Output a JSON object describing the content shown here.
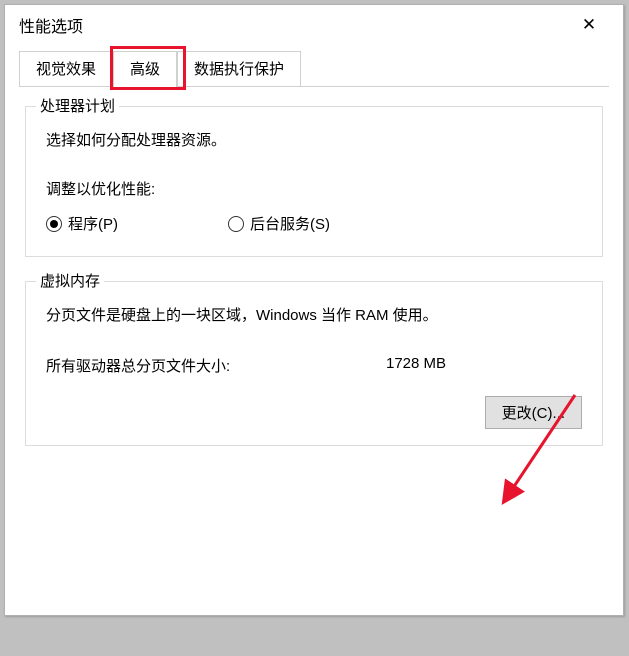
{
  "window": {
    "title": "性能选项"
  },
  "tabs": {
    "visual_effects": "视觉效果",
    "advanced": "高级",
    "dep": "数据执行保护"
  },
  "processor": {
    "legend": "处理器计划",
    "desc": "选择如何分配处理器资源。",
    "adjust_label": "调整以优化性能:",
    "radio_programs": "程序(P)",
    "radio_background": "后台服务(S)"
  },
  "virtual_memory": {
    "legend": "虚拟内存",
    "desc": "分页文件是硬盘上的一块区域，Windows 当作 RAM 使用。",
    "total_label": "所有驱动器总分页文件大小:",
    "total_value": "1728 MB",
    "change_button": "更改(C)..."
  },
  "annotations": {
    "highlight_color": "#e8142e",
    "arrow_color": "#e8142e"
  }
}
